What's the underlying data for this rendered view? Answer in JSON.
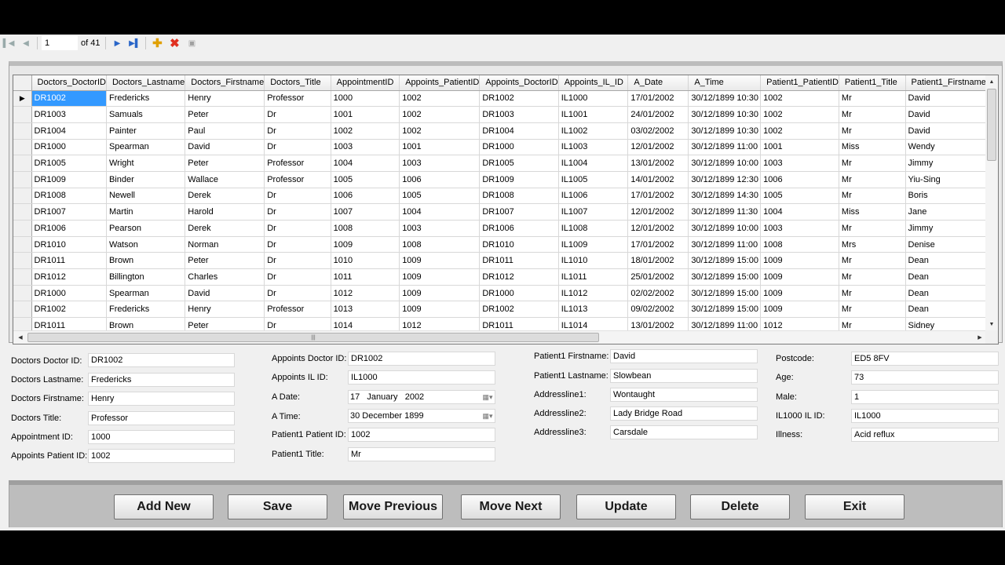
{
  "navigator": {
    "position": "1",
    "of_label": "of 41",
    "icons": [
      "move-first-icon",
      "move-previous-icon",
      "move-next-icon",
      "move-last-icon",
      "add-new-icon",
      "delete-icon",
      "save-icon"
    ]
  },
  "grid": {
    "columns": [
      "Doctors_DoctorID",
      "Doctors_Lastname",
      "Doctors_Firstname",
      "Doctors_Title",
      "AppointmentID",
      "Appoints_PatientID",
      "Appoints_DoctorID",
      "Appoints_IL_ID",
      "A_Date",
      "A_Time",
      "Patient1_PatientID",
      "Patient1_Title",
      "Patient1_Firstname"
    ],
    "current_row_marker": "▶",
    "rows": [
      [
        "DR1002",
        "Fredericks",
        "Henry",
        "Professor",
        "1000",
        "1002",
        "DR1002",
        "IL1000",
        "17/01/2002",
        "30/12/1899 10:30",
        "1002",
        "Mr",
        "David"
      ],
      [
        "DR1003",
        "Samuals",
        "Peter",
        "Dr",
        "1001",
        "1002",
        "DR1003",
        "IL1001",
        "24/01/2002",
        "30/12/1899 10:30",
        "1002",
        "Mr",
        "David"
      ],
      [
        "DR1004",
        "Painter",
        "Paul",
        "Dr",
        "1002",
        "1002",
        "DR1004",
        "IL1002",
        "03/02/2002",
        "30/12/1899 10:30",
        "1002",
        "Mr",
        "David"
      ],
      [
        "DR1000",
        "Spearman",
        "David",
        "Dr",
        "1003",
        "1001",
        "DR1000",
        "IL1003",
        "12/01/2002",
        "30/12/1899 11:00",
        "1001",
        "Miss",
        "Wendy"
      ],
      [
        "DR1005",
        "Wright",
        "Peter",
        "Professor",
        "1004",
        "1003",
        "DR1005",
        "IL1004",
        "13/01/2002",
        "30/12/1899 10:00",
        "1003",
        "Mr",
        "Jimmy"
      ],
      [
        "DR1009",
        "Binder",
        "Wallace",
        "Professor",
        "1005",
        "1006",
        "DR1009",
        "IL1005",
        "14/01/2002",
        "30/12/1899 12:30",
        "1006",
        "Mr",
        "Yiu-Sing"
      ],
      [
        "DR1008",
        "Newell",
        "Derek",
        "Dr",
        "1006",
        "1005",
        "DR1008",
        "IL1006",
        "17/01/2002",
        "30/12/1899 14:30",
        "1005",
        "Mr",
        "Boris"
      ],
      [
        "DR1007",
        "Martin",
        "Harold",
        "Dr",
        "1007",
        "1004",
        "DR1007",
        "IL1007",
        "12/01/2002",
        "30/12/1899 11:30",
        "1004",
        "Miss",
        "Jane"
      ],
      [
        "DR1006",
        "Pearson",
        "Derek",
        "Dr",
        "1008",
        "1003",
        "DR1006",
        "IL1008",
        "12/01/2002",
        "30/12/1899 10:00",
        "1003",
        "Mr",
        "Jimmy"
      ],
      [
        "DR1010",
        "Watson",
        "Norman",
        "Dr",
        "1009",
        "1008",
        "DR1010",
        "IL1009",
        "17/01/2002",
        "30/12/1899 11:00",
        "1008",
        "Mrs",
        "Denise"
      ],
      [
        "DR1011",
        "Brown",
        "Peter",
        "Dr",
        "1010",
        "1009",
        "DR1011",
        "IL1010",
        "18/01/2002",
        "30/12/1899 15:00",
        "1009",
        "Mr",
        "Dean"
      ],
      [
        "DR1012",
        "Billington",
        "Charles",
        "Dr",
        "1011",
        "1009",
        "DR1012",
        "IL1011",
        "25/01/2002",
        "30/12/1899 15:00",
        "1009",
        "Mr",
        "Dean"
      ],
      [
        "DR1000",
        "Spearman",
        "David",
        "Dr",
        "1012",
        "1009",
        "DR1000",
        "IL1012",
        "02/02/2002",
        "30/12/1899 15:00",
        "1009",
        "Mr",
        "Dean"
      ],
      [
        "DR1002",
        "Fredericks",
        "Henry",
        "Professor",
        "1013",
        "1009",
        "DR1002",
        "IL1013",
        "09/02/2002",
        "30/12/1899 15:00",
        "1009",
        "Mr",
        "Dean"
      ],
      [
        "DR1011",
        "Brown",
        "Peter",
        "Dr",
        "1014",
        "1012",
        "DR1011",
        "IL1014",
        "13/01/2002",
        "30/12/1899 11:00",
        "1012",
        "Mr",
        "Sidney"
      ]
    ]
  },
  "form": {
    "col1": [
      {
        "label": "Doctors Doctor ID:",
        "value": "DR1002"
      },
      {
        "label": "Doctors Lastname:",
        "value": "Fredericks"
      },
      {
        "label": "Doctors Firstname:",
        "value": "Henry"
      },
      {
        "label": "Doctors Title:",
        "value": "Professor"
      },
      {
        "label": "Appointment ID:",
        "value": "1000"
      },
      {
        "label": "Appoints Patient ID:",
        "value": "1002"
      }
    ],
    "col2": [
      {
        "label": "Appoints Doctor ID:",
        "value": "DR1002"
      },
      {
        "label": "Appoints IL ID:",
        "value": "IL1000"
      },
      {
        "label": "A Date:",
        "value": "17   January   2002"
      },
      {
        "label": "A Time:",
        "value": "30 December 1899"
      },
      {
        "label": "Patient1 Patient ID:",
        "value": "1002"
      },
      {
        "label": "Patient1 Title:",
        "value": "Mr"
      }
    ],
    "col3": [
      {
        "label": "Patient1 Firstname:",
        "value": "David"
      },
      {
        "label": "Patient1 Lastname:",
        "value": "Slowbean"
      },
      {
        "label": "Addressline1:",
        "value": "Wontaught"
      },
      {
        "label": "Addressline2:",
        "value": "Lady Bridge Road"
      },
      {
        "label": "Addressline3:",
        "value": "Carsdale"
      }
    ],
    "col4": [
      {
        "label": "Postcode:",
        "value": "ED5 8FV"
      },
      {
        "label": "Age:",
        "value": "73"
      },
      {
        "label": "Male:",
        "value": "1"
      },
      {
        "label": "IL1000 IL ID:",
        "value": "IL1000"
      },
      {
        "label": "Illness:",
        "value": "Acid reflux"
      }
    ]
  },
  "buttons": {
    "add_new": "Add New",
    "save": "Save",
    "move_previous": "Move Previous",
    "move_next": "Move Next",
    "update": "Update",
    "delete": "Delete",
    "exit": "Exit"
  },
  "colors": {
    "selection": "#3399ff",
    "panel": "#f0f0f0",
    "button_bar": "#bdbdbd"
  }
}
